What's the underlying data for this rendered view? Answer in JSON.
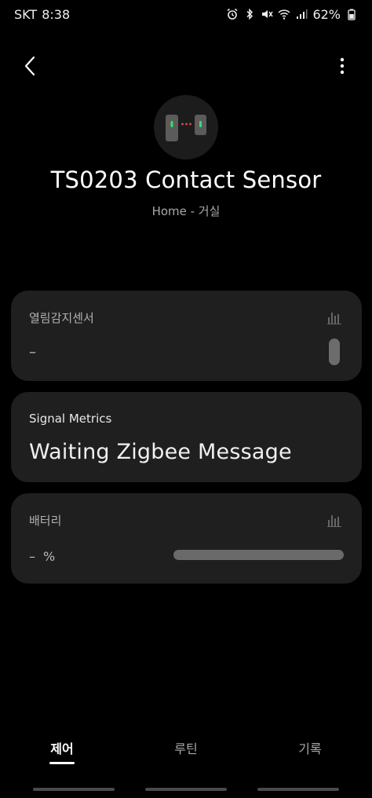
{
  "status_bar": {
    "carrier": "SKT",
    "time": "8:38",
    "battery_percent": "62%"
  },
  "device": {
    "title": "TS0203 Contact Sensor",
    "location": "Home - 거실"
  },
  "cards": {
    "contact": {
      "title": "열림감지센서",
      "value": "–"
    },
    "signal": {
      "title": "Signal Metrics",
      "value": "Waiting Zigbee Message"
    },
    "battery": {
      "title": "배터리",
      "value": "–",
      "unit": "%"
    }
  },
  "bottom_nav": {
    "tabs": [
      {
        "label": "제어",
        "active": true
      },
      {
        "label": "루틴",
        "active": false
      },
      {
        "label": "기록",
        "active": false
      }
    ]
  },
  "icons": {
    "back": "back-arrow-icon",
    "more": "more-vert-icon",
    "graph": "bar-chart-icon",
    "device": "contact-sensor-icon"
  },
  "colors": {
    "background": "#000000",
    "card": "#1f1f1f",
    "sensor_led_green": "#3ddc6a",
    "sensor_led_red": "#e04a4a"
  }
}
